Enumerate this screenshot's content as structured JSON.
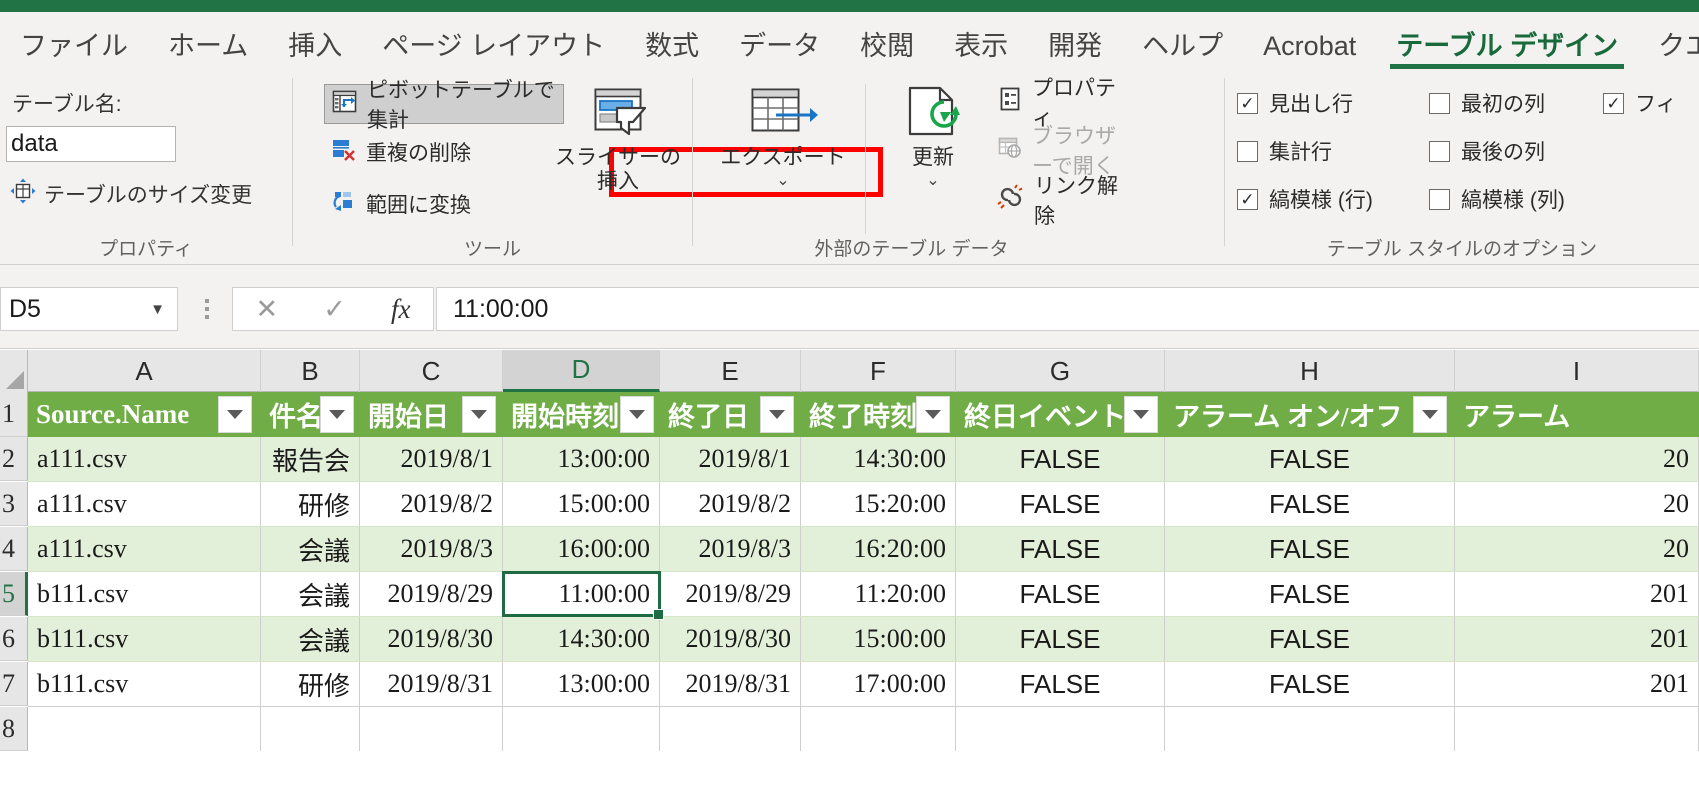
{
  "theme": {
    "excel_green": "#217346",
    "table_header_green": "#70ad47",
    "banded_row_green": "#e2efd9",
    "highlight_red": "#ff0000",
    "ribbon_bg": "#f3f2f1"
  },
  "ribbon_tabs": [
    {
      "label": "ファイル",
      "active": false
    },
    {
      "label": "ホーム",
      "active": false
    },
    {
      "label": "挿入",
      "active": false
    },
    {
      "label": "ページ レイアウト",
      "active": false
    },
    {
      "label": "数式",
      "active": false
    },
    {
      "label": "データ",
      "active": false
    },
    {
      "label": "校閲",
      "active": false
    },
    {
      "label": "表示",
      "active": false
    },
    {
      "label": "開発",
      "active": false
    },
    {
      "label": "ヘルプ",
      "active": false
    },
    {
      "label": "Acrobat",
      "active": false
    },
    {
      "label": "テーブル デザイン",
      "active": true
    },
    {
      "label": "クエリ",
      "active": false
    }
  ],
  "ribbon": {
    "properties_group": {
      "group_label": "プロパティ",
      "table_name_label": "テーブル名:",
      "table_name_value": "data",
      "resize_table_label": "テーブルのサイズ変更"
    },
    "tools_group": {
      "group_label": "ツール",
      "summarize_with_pivot_label": "ピボットテーブルで集計",
      "remove_duplicates_label": "重複の削除",
      "convert_to_range_label": "範囲に変換",
      "insert_slicer_label_line1": "スライサーの",
      "insert_slicer_label_line2": "挿入"
    },
    "external_data_group": {
      "group_label": "外部のテーブル データ",
      "export_label": "エクスポート",
      "refresh_label": "更新",
      "properties_label": "プロパティ",
      "open_in_browser_label": "ブラウザーで開く",
      "unlink_label": "リンク解除"
    },
    "table_style_options_group": {
      "group_label": "テーブル スタイルのオプション",
      "options": [
        {
          "label": "見出し行",
          "checked": true
        },
        {
          "label": "集計行",
          "checked": false
        },
        {
          "label": "縞模様 (行)",
          "checked": true
        },
        {
          "label": "最初の列",
          "checked": false
        },
        {
          "label": "最後の列",
          "checked": false
        },
        {
          "label": "縞模様 (列)",
          "checked": false
        },
        {
          "label": "フィ",
          "checked": true
        }
      ]
    }
  },
  "formula_bar": {
    "name_box_value": "D5",
    "cancel_icon": "✕",
    "confirm_icon": "✓",
    "function_icon": "fx",
    "formula_value": "11:00:00"
  },
  "grid": {
    "column_letters": [
      "A",
      "B",
      "C",
      "D",
      "E",
      "F",
      "G",
      "H",
      "I"
    ],
    "selected_column": "D",
    "row_numbers": [
      "1",
      "2",
      "3",
      "4",
      "5",
      "6",
      "7",
      "8"
    ],
    "selected_row": "5",
    "selected_cell": "D5",
    "headers": [
      "Source.Name",
      "件名",
      "開始日",
      "開始時刻",
      "終了日",
      "終了時刻",
      "終日イベント",
      "アラーム オン/オフ",
      "アラーム"
    ],
    "rows": [
      {
        "row": "2",
        "banded": true,
        "cells": [
          "a111.csv",
          "報告会",
          "2019/8/1",
          "13:00:00",
          "2019/8/1",
          "14:30:00",
          "FALSE",
          "FALSE",
          "20"
        ]
      },
      {
        "row": "3",
        "banded": false,
        "cells": [
          "a111.csv",
          "研修",
          "2019/8/2",
          "15:00:00",
          "2019/8/2",
          "15:20:00",
          "FALSE",
          "FALSE",
          "20"
        ]
      },
      {
        "row": "4",
        "banded": true,
        "cells": [
          "a111.csv",
          "会議",
          "2019/8/3",
          "16:00:00",
          "2019/8/3",
          "16:20:00",
          "FALSE",
          "FALSE",
          "20"
        ]
      },
      {
        "row": "5",
        "banded": false,
        "cells": [
          "b111.csv",
          "会議",
          "2019/8/29",
          "11:00:00",
          "2019/8/29",
          "11:20:00",
          "FALSE",
          "FALSE",
          "201"
        ]
      },
      {
        "row": "6",
        "banded": true,
        "cells": [
          "b111.csv",
          "会議",
          "2019/8/30",
          "14:30:00",
          "2019/8/30",
          "15:00:00",
          "FALSE",
          "FALSE",
          "201"
        ]
      },
      {
        "row": "7",
        "banded": false,
        "cells": [
          "b111.csv",
          "研修",
          "2019/8/31",
          "13:00:00",
          "2019/8/31",
          "17:00:00",
          "FALSE",
          "FALSE",
          "201"
        ]
      },
      {
        "row": "8",
        "banded": false,
        "cells": [
          "",
          "",
          "",
          "",
          "",
          "",
          "",
          "",
          ""
        ]
      }
    ]
  }
}
